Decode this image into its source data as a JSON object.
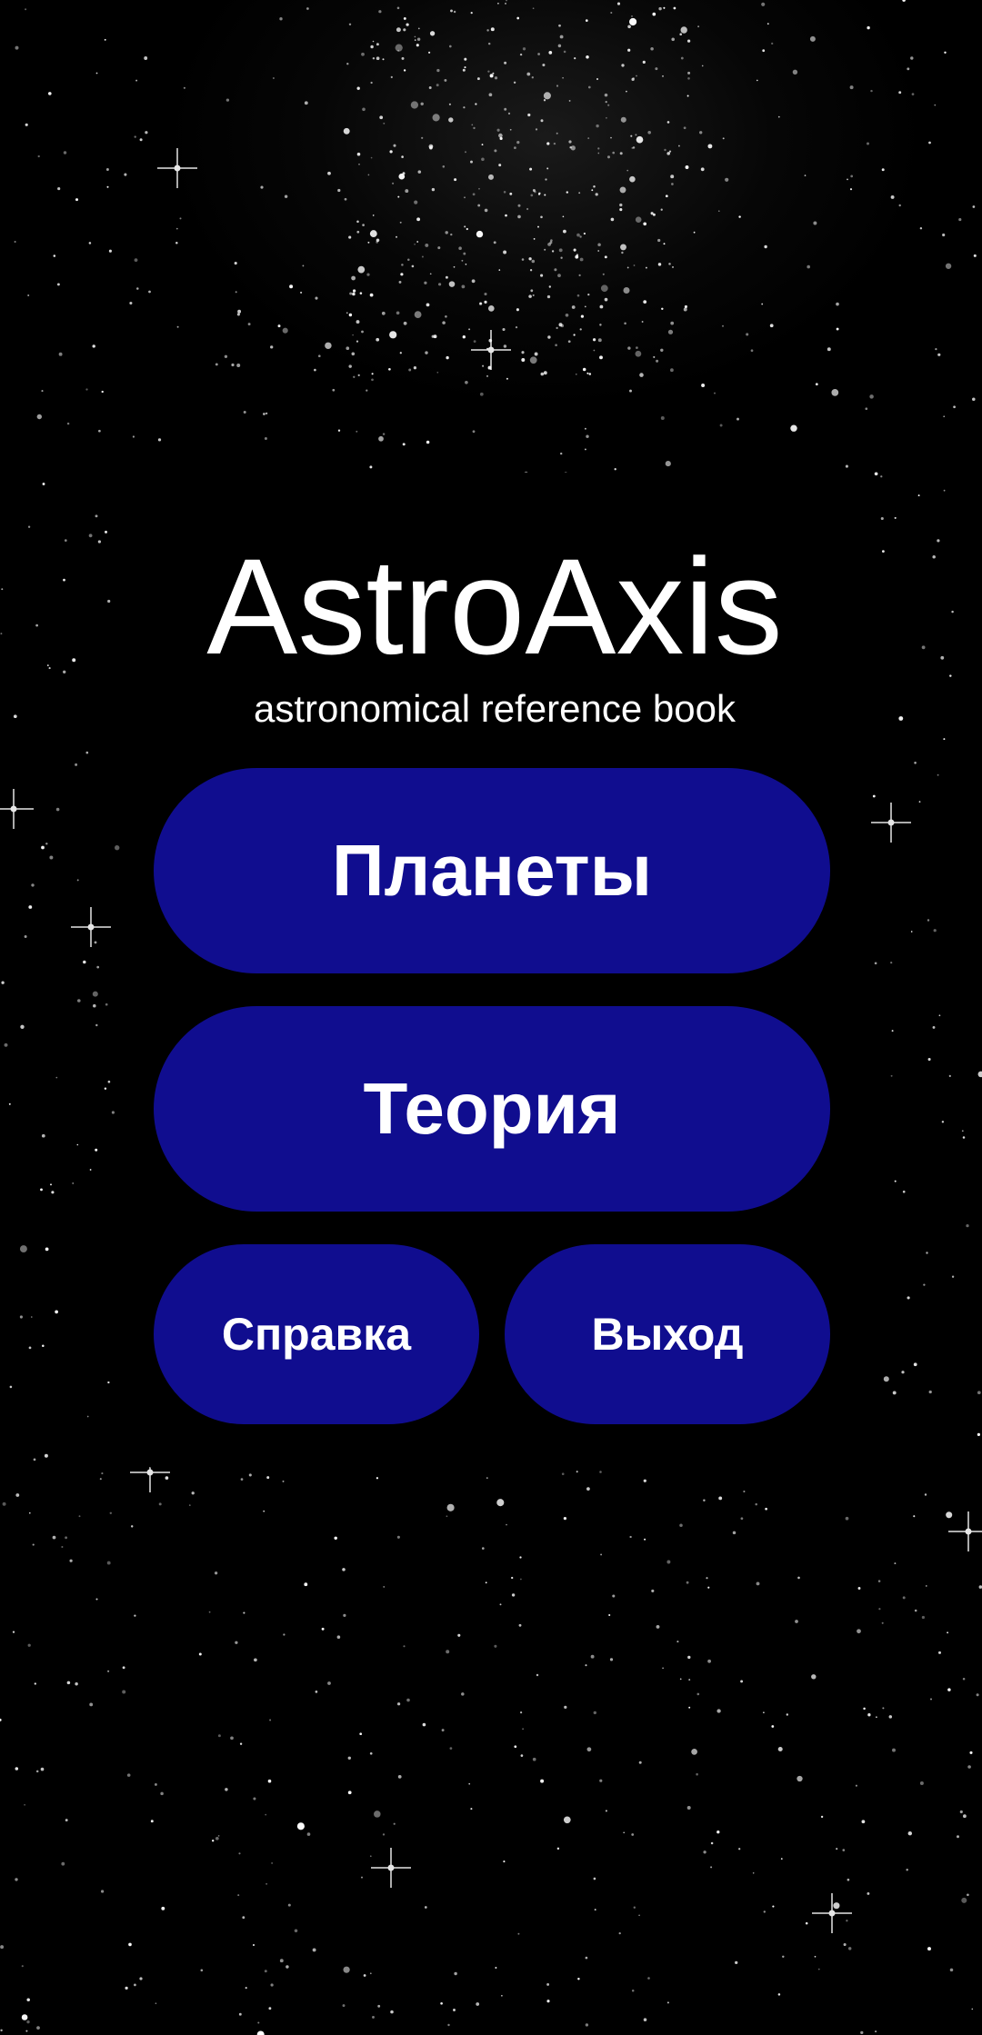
{
  "app": {
    "title": "AstroAxis",
    "subtitle": "astronomical reference book"
  },
  "menu": {
    "planets_label": "Планеты",
    "theory_label": "Теория",
    "help_label": "Справка",
    "exit_label": "Выход"
  },
  "colors": {
    "background": "#000000",
    "card": "#000000",
    "button": "#100d8f",
    "text": "#ffffff"
  }
}
